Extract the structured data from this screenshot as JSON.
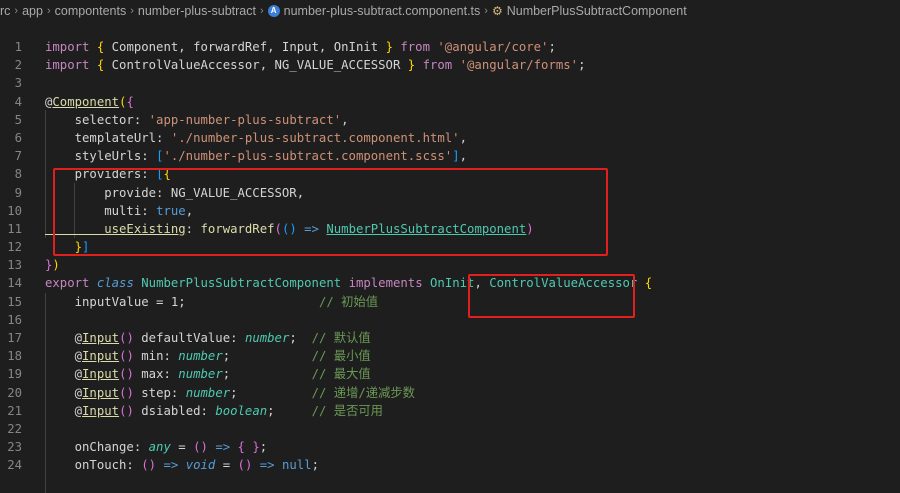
{
  "breadcrumb": {
    "items": [
      "rc",
      "app",
      "compontents",
      "number-plus-subtract"
    ],
    "file": "number-plus-subtract.component.ts",
    "symbol": "NumberPlusSubtractComponent"
  },
  "lines": [
    {
      "n": "1",
      "t": [
        [
          "kw",
          "import"
        ],
        [
          "pl",
          " "
        ],
        [
          "br1",
          "{"
        ],
        [
          "pl",
          " Component, forwardRef, Input, OnInit "
        ],
        [
          "br1",
          "}"
        ],
        [
          "pl",
          " "
        ],
        [
          "kw",
          "from"
        ],
        [
          "pl",
          " "
        ],
        [
          "str",
          "'@angular/core'"
        ],
        [
          "pl",
          ";"
        ]
      ]
    },
    {
      "n": "2",
      "t": [
        [
          "kw",
          "import"
        ],
        [
          "pl",
          " "
        ],
        [
          "br1",
          "{"
        ],
        [
          "pl",
          " ControlValueAccessor, NG_VALUE_ACCESSOR "
        ],
        [
          "br1",
          "}"
        ],
        [
          "pl",
          " "
        ],
        [
          "kw",
          "from"
        ],
        [
          "pl",
          " "
        ],
        [
          "str",
          "'@angular/forms'"
        ],
        [
          "pl",
          ";"
        ]
      ]
    },
    {
      "n": "3",
      "t": []
    },
    {
      "n": "4",
      "t": [
        [
          "pl",
          "@"
        ],
        [
          "fn ul",
          "Component"
        ],
        [
          "br1",
          "("
        ],
        [
          "br2",
          "{"
        ]
      ]
    },
    {
      "n": "5",
      "t": [
        [
          "pl",
          "    selector: "
        ],
        [
          "str",
          "'app-number-plus-subtract'"
        ],
        [
          "pl",
          ","
        ]
      ]
    },
    {
      "n": "6",
      "t": [
        [
          "pl",
          "    templateUrl: "
        ],
        [
          "str",
          "'./number-plus-subtract.component.html'"
        ],
        [
          "pl",
          ","
        ]
      ]
    },
    {
      "n": "7",
      "t": [
        [
          "pl",
          "    styleUrls: "
        ],
        [
          "br3",
          "["
        ],
        [
          "str",
          "'./number-plus-subtract.component.scss'"
        ],
        [
          "br3",
          "]"
        ],
        [
          "pl",
          ","
        ]
      ]
    },
    {
      "n": "8",
      "t": [
        [
          "pl",
          "    providers: "
        ],
        [
          "br3",
          "["
        ],
        [
          "br1",
          "{"
        ]
      ]
    },
    {
      "n": "9",
      "t": [
        [
          "pl",
          "        provide: NG_VALUE_ACCESSOR,"
        ]
      ]
    },
    {
      "n": "10",
      "t": [
        [
          "pl",
          "        multi: "
        ],
        [
          "kb",
          "true"
        ],
        [
          "pl",
          ","
        ]
      ]
    },
    {
      "n": "11",
      "t": [
        [
          "fn ul",
          "        useExisting"
        ],
        [
          "pl",
          ": "
        ],
        [
          "fn",
          "forwardRef"
        ],
        [
          "br2",
          "("
        ],
        [
          "br3",
          "("
        ],
        [
          "br3",
          ")"
        ],
        [
          "pl",
          " "
        ],
        [
          "kb",
          "=>"
        ],
        [
          "pl",
          " "
        ],
        [
          "cls ul",
          "NumberPlusSubtractComponent"
        ],
        [
          "br2",
          ")"
        ]
      ]
    },
    {
      "n": "12",
      "t": [
        [
          "pl",
          "    "
        ],
        [
          "br1",
          "}"
        ],
        [
          "br3",
          "]"
        ]
      ]
    },
    {
      "n": "13",
      "t": [
        [
          "br2",
          "}"
        ],
        [
          "br1",
          ")"
        ]
      ]
    },
    {
      "n": "14",
      "t": [
        [
          "kw",
          "export"
        ],
        [
          "pl",
          " "
        ],
        [
          "kb it",
          "class"
        ],
        [
          "pl",
          " "
        ],
        [
          "cls",
          "NumberPlusSubtractComponent"
        ],
        [
          "pl",
          " "
        ],
        [
          "kw",
          "implements"
        ],
        [
          "pl",
          " "
        ],
        [
          "cls",
          "OnInit"
        ],
        [
          "pl",
          ", "
        ],
        [
          "cls",
          "ControlValueAccessor"
        ],
        [
          "pl",
          " "
        ],
        [
          "br1",
          "{"
        ]
      ]
    },
    {
      "n": "15",
      "t": [
        [
          "pl",
          "    inputValue = 1;                  "
        ],
        [
          "cm",
          "// 初始值"
        ]
      ]
    },
    {
      "n": "16",
      "t": []
    },
    {
      "n": "17",
      "t": [
        [
          "pl",
          "    @"
        ],
        [
          "fn ul",
          "Input"
        ],
        [
          "br2",
          "("
        ],
        [
          "br2",
          ")"
        ],
        [
          "pl",
          " defaultValue: "
        ],
        [
          "cls it",
          "number"
        ],
        [
          "pl",
          ";  "
        ],
        [
          "cm",
          "// 默认值"
        ]
      ]
    },
    {
      "n": "18",
      "t": [
        [
          "pl",
          "    @"
        ],
        [
          "fn ul",
          "Input"
        ],
        [
          "br2",
          "("
        ],
        [
          "br2",
          ")"
        ],
        [
          "pl",
          " min: "
        ],
        [
          "cls it",
          "number"
        ],
        [
          "pl",
          ";           "
        ],
        [
          "cm",
          "// 最小值"
        ]
      ]
    },
    {
      "n": "19",
      "t": [
        [
          "pl",
          "    @"
        ],
        [
          "fn ul",
          "Input"
        ],
        [
          "br2",
          "("
        ],
        [
          "br2",
          ")"
        ],
        [
          "pl",
          " max: "
        ],
        [
          "cls it",
          "number"
        ],
        [
          "pl",
          ";           "
        ],
        [
          "cm",
          "// 最大值"
        ]
      ]
    },
    {
      "n": "20",
      "t": [
        [
          "pl",
          "    @"
        ],
        [
          "fn ul",
          "Input"
        ],
        [
          "br2",
          "("
        ],
        [
          "br2",
          ")"
        ],
        [
          "pl",
          " step: "
        ],
        [
          "cls it",
          "number"
        ],
        [
          "pl",
          ";          "
        ],
        [
          "cm",
          "// 递增/递减步数"
        ]
      ]
    },
    {
      "n": "21",
      "t": [
        [
          "pl",
          "    @"
        ],
        [
          "fn ul",
          "Input"
        ],
        [
          "br2",
          "("
        ],
        [
          "br2",
          ")"
        ],
        [
          "pl",
          " dsiabled: "
        ],
        [
          "cls it",
          "boolean"
        ],
        [
          "pl",
          ";     "
        ],
        [
          "cm",
          "// 是否可用"
        ]
      ]
    },
    {
      "n": "22",
      "t": []
    },
    {
      "n": "23",
      "t": [
        [
          "pl",
          "    onChange: "
        ],
        [
          "cls it",
          "any"
        ],
        [
          "pl",
          " = "
        ],
        [
          "br2",
          "("
        ],
        [
          "br2",
          ")"
        ],
        [
          "pl",
          " "
        ],
        [
          "kb",
          "=>"
        ],
        [
          "pl",
          " "
        ],
        [
          "br2",
          "{"
        ],
        [
          "pl",
          " "
        ],
        [
          "br2",
          "}"
        ],
        [
          "pl",
          ";"
        ]
      ]
    },
    {
      "n": "24",
      "t": [
        [
          "pl",
          "    onTouch: "
        ],
        [
          "br2",
          "("
        ],
        [
          "br2",
          ")"
        ],
        [
          "pl",
          " "
        ],
        [
          "kb",
          "=>"
        ],
        [
          "pl",
          " "
        ],
        [
          "kb it",
          "void"
        ],
        [
          "pl",
          " = "
        ],
        [
          "br2",
          "("
        ],
        [
          "br2",
          ")"
        ],
        [
          "pl",
          " "
        ],
        [
          "kb",
          "=>"
        ],
        [
          "pl",
          " "
        ],
        [
          "kb",
          "null"
        ],
        [
          "pl",
          ";"
        ]
      ]
    }
  ]
}
